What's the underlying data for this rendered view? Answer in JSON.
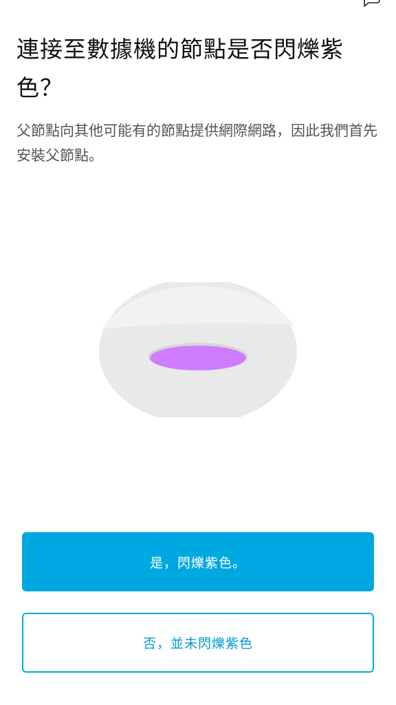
{
  "header": {
    "corner_icon": "chat-bubble-icon"
  },
  "main": {
    "title": "連接至數據機的節點是否閃爍紫色？",
    "description": "父節點向其他可能有的節點提供網際網路，因此我們首先安裝父節點。",
    "illustration": {
      "name": "node-device-illustration",
      "body_color": "#e9e9e9",
      "light_color": "#cf7cff"
    }
  },
  "actions": {
    "yes_label": "是，閃爍紫色。",
    "no_label": "否，並未閃爍紫色"
  },
  "colors": {
    "accent": "#00a8e1",
    "text": "#111111",
    "secondary_text": "#555555"
  }
}
